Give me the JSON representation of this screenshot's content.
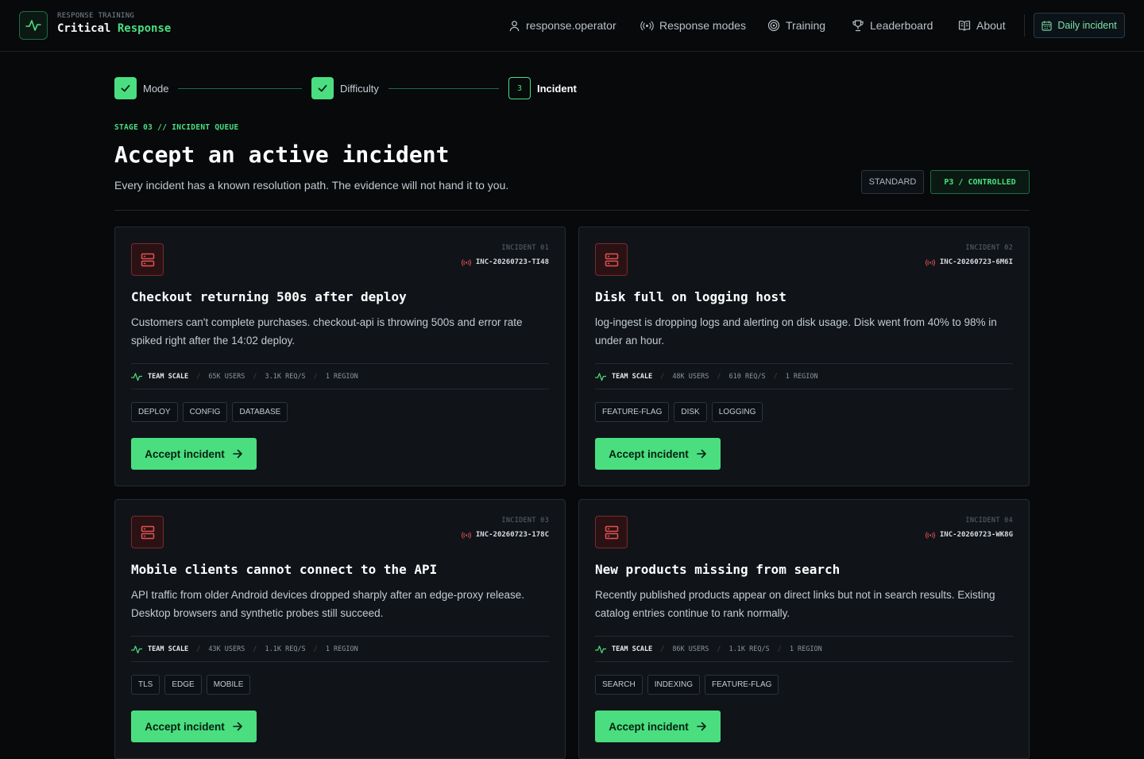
{
  "header": {
    "brand_kicker": "RESPONSE TRAINING",
    "brand_name_primary": "Critical",
    "brand_name_accent": "Response",
    "nav": [
      {
        "label": "response.operator",
        "icon": "user-icon"
      },
      {
        "label": "Response modes",
        "icon": "broadcast-icon"
      },
      {
        "label": "Training",
        "icon": "target-icon"
      },
      {
        "label": "Leaderboard",
        "icon": "trophy-icon"
      },
      {
        "label": "About",
        "icon": "book-icon"
      }
    ],
    "daily_incident_label": "Daily incident"
  },
  "stepper": {
    "steps": [
      {
        "label": "Mode",
        "state": "complete"
      },
      {
        "label": "Difficulty",
        "state": "complete"
      },
      {
        "label": "Incident",
        "state": "active",
        "number": "3"
      }
    ]
  },
  "page": {
    "stage": "STAGE 03 // INCIDENT QUEUE",
    "title": "Accept an active incident",
    "subtitle": "Every incident has a known resolution path. The evidence will not hand it to you.",
    "mode_pill": "STANDARD",
    "priority_pill": "P3 / CONTROLLED"
  },
  "cards": [
    {
      "index": "INCIDENT 01",
      "id": "INC-20260723-TI48",
      "title": "Checkout returning 500s after deploy",
      "description": "Customers can't complete purchases. checkout-api is throwing 500s and error rate spiked right after the 14:02 deploy.",
      "scale_label": "TEAM SCALE",
      "users": "65K USERS",
      "rps": "3.1K REQ/S",
      "regions": "1 REGION",
      "tags": [
        "DEPLOY",
        "CONFIG",
        "DATABASE"
      ],
      "accept_label": "Accept incident"
    },
    {
      "index": "INCIDENT 02",
      "id": "INC-20260723-6M6I",
      "title": "Disk full on logging host",
      "description": "log-ingest is dropping logs and alerting on disk usage. Disk went from 40% to 98% in under an hour.",
      "scale_label": "TEAM SCALE",
      "users": "48K USERS",
      "rps": "610 REQ/S",
      "regions": "1 REGION",
      "tags": [
        "FEATURE-FLAG",
        "DISK",
        "LOGGING"
      ],
      "accept_label": "Accept incident"
    },
    {
      "index": "INCIDENT 03",
      "id": "INC-20260723-178C",
      "title": "Mobile clients cannot connect to the API",
      "description": "API traffic from older Android devices dropped sharply after an edge-proxy release. Desktop browsers and synthetic probes still succeed.",
      "scale_label": "TEAM SCALE",
      "users": "43K USERS",
      "rps": "1.1K REQ/S",
      "regions": "1 REGION",
      "tags": [
        "TLS",
        "EDGE",
        "MOBILE"
      ],
      "accept_label": "Accept incident"
    },
    {
      "index": "INCIDENT 04",
      "id": "INC-20260723-WK8G",
      "title": "New products missing from search",
      "description": "Recently published products appear on direct links but not in search results. Existing catalog entries continue to rank normally.",
      "scale_label": "TEAM SCALE",
      "users": "86K USERS",
      "rps": "1.1K REQ/S",
      "regions": "1 REGION",
      "tags": [
        "SEARCH",
        "INDEXING",
        "FEATURE-FLAG"
      ],
      "accept_label": "Accept incident"
    }
  ],
  "colors": {
    "accent": "#4ade80",
    "background": "#07090b",
    "card": "#101418",
    "severity": "#e05252"
  }
}
